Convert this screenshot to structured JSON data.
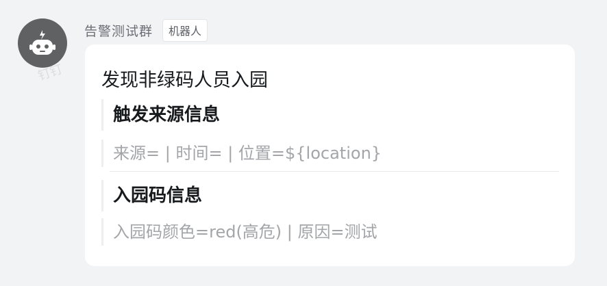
{
  "sender": {
    "name": "告警测试群",
    "badge": "机器人"
  },
  "watermark": "钉钉",
  "card": {
    "title": "发现非绿码人员入园",
    "sections": [
      {
        "heading": "触发来源信息",
        "text": "来源= | 时间= | 位置=${location}"
      },
      {
        "heading": "入园码信息",
        "text": "入园码颜色=red(高危) | 原因=测试"
      }
    ]
  }
}
